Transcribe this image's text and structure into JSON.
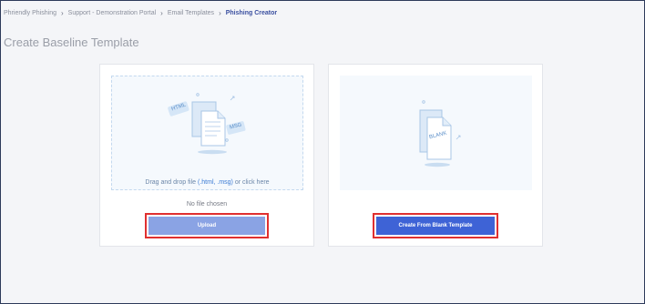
{
  "breadcrumb": {
    "items": [
      "Phriendly Phishing",
      "Support - Demonstration Portal",
      "Email Templates"
    ],
    "current": "Phishing Creator"
  },
  "page": {
    "title": "Create Baseline Template"
  },
  "upload_card": {
    "drop_text_prefix": "Drag and drop file ",
    "drop_text_ext": "(.html, .msg)",
    "drop_text_suffix": " or click here",
    "tag_html": "HTML",
    "tag_msg": "MSG",
    "no_file_text": "No file chosen",
    "upload_label": "Upload"
  },
  "blank_card": {
    "doc_label": "BLANK",
    "create_label": "Create From Blank Template"
  },
  "colors": {
    "accent": "#3e63d6",
    "accent_disabled": "#8aa3e4",
    "highlight": "#e03030"
  }
}
